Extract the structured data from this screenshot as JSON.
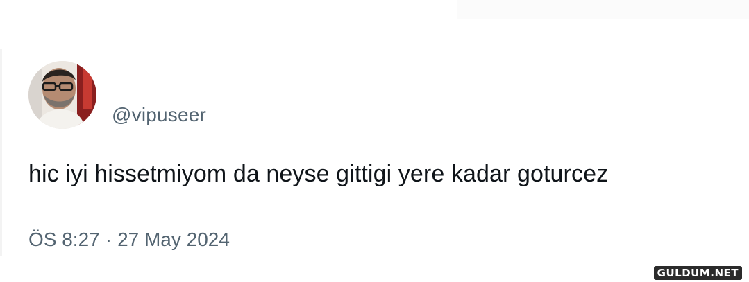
{
  "tweet": {
    "handle": "@vipuseer",
    "text": "hic iyi hissetmiyom da neyse gittigi yere kadar goturcez",
    "time": "ÖS 8:27",
    "separator": "·",
    "date": "27 May 2024",
    "avatar_icon": "profile-photo-icon"
  },
  "watermark": {
    "text": "GULDUM.NET"
  },
  "colors": {
    "text_primary": "#0f1419",
    "text_secondary": "#536471",
    "background": "#ffffff"
  }
}
